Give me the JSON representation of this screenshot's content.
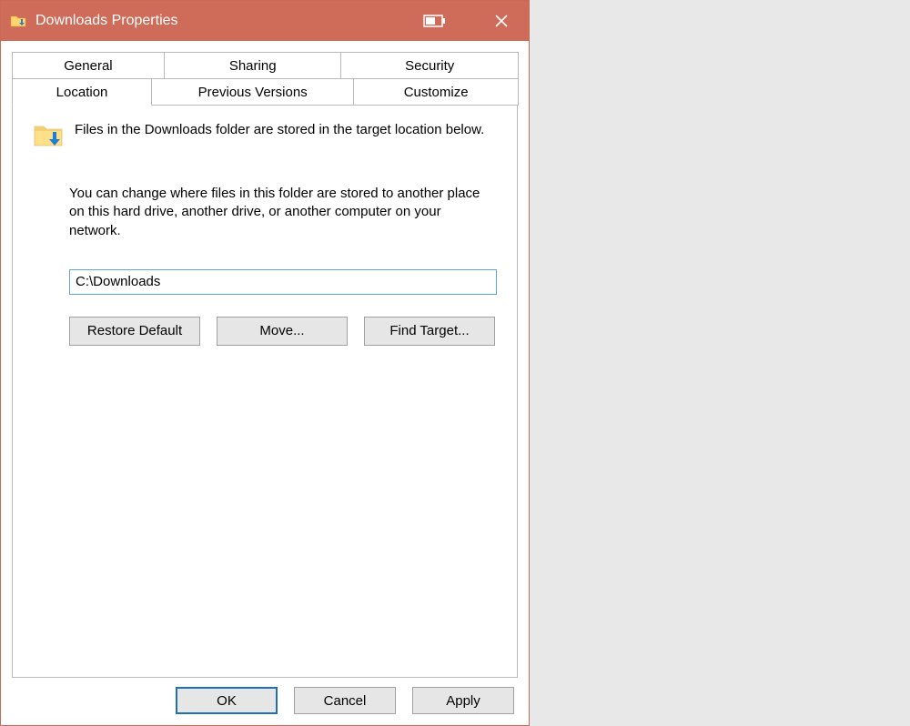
{
  "window": {
    "title": "Downloads Properties"
  },
  "tabs": {
    "row_back": [
      "General",
      "Sharing",
      "Security"
    ],
    "row_front": [
      "Location",
      "Previous Versions",
      "Customize"
    ],
    "active": "Location"
  },
  "location": {
    "desc1": "Files in the Downloads folder are stored in the target location below.",
    "desc2": "You can change where files in this folder are stored to another place on this hard drive, another drive, or another computer on your network.",
    "path": "C:\\Downloads",
    "buttons": {
      "restore": "Restore Default",
      "move": "Move...",
      "find": "Find Target..."
    }
  },
  "dialog_buttons": {
    "ok": "OK",
    "cancel": "Cancel",
    "apply": "Apply"
  }
}
